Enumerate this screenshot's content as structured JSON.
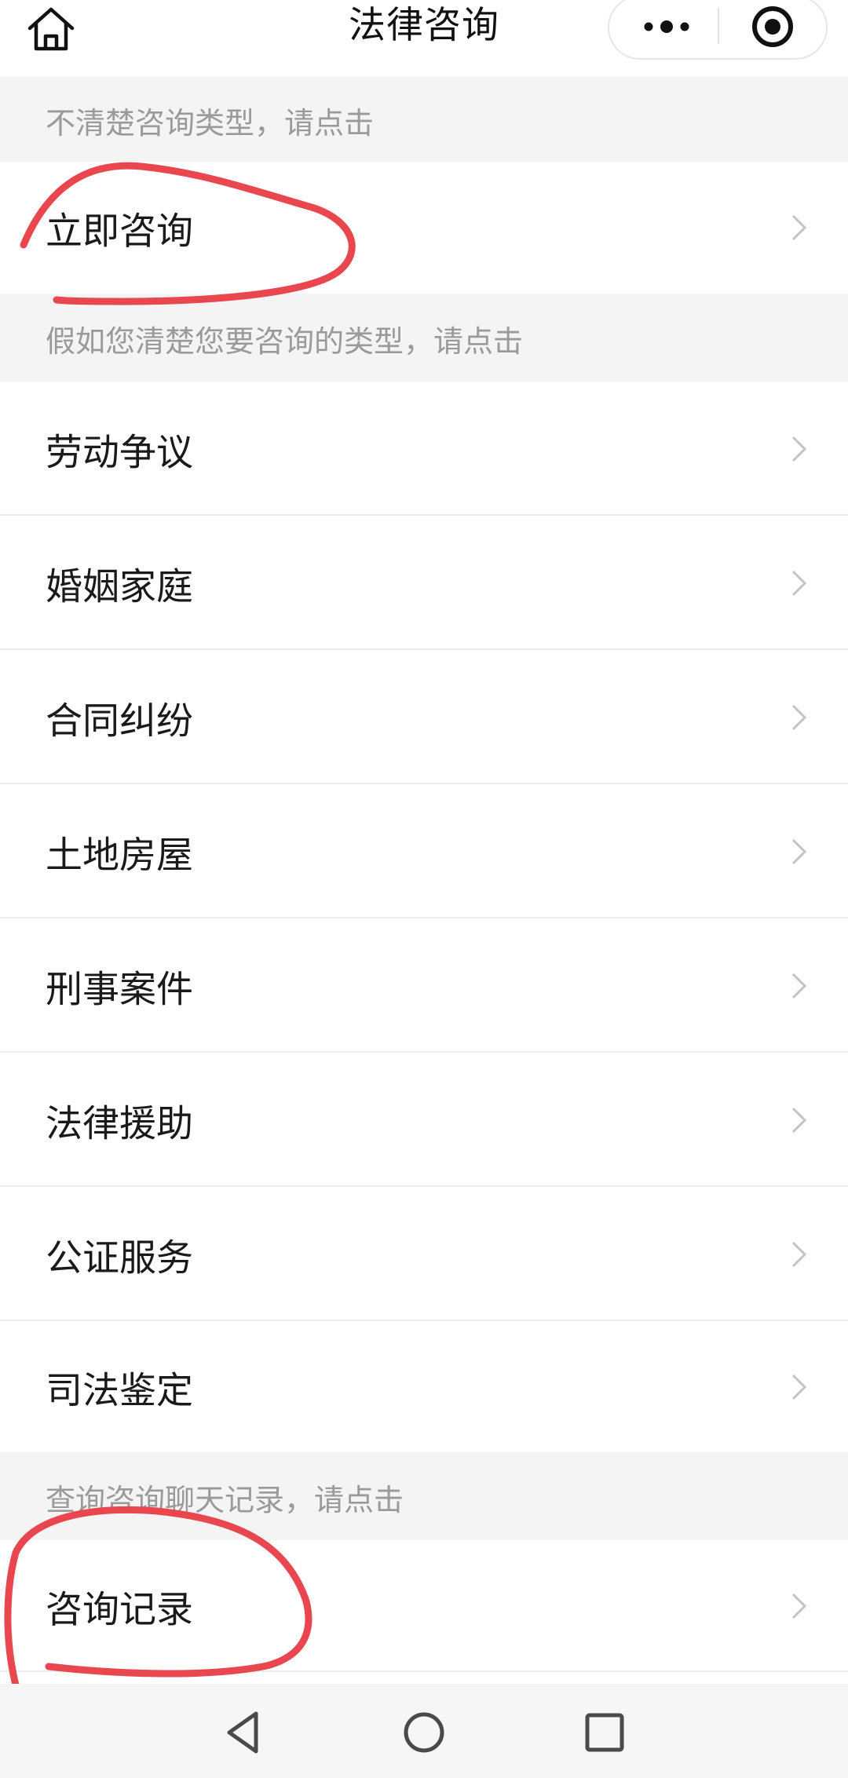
{
  "header": {
    "title": "法律咨询",
    "home_icon": "home-icon",
    "more_icon": "more-dots-icon",
    "close_icon": "target-circle-icon"
  },
  "sections": {
    "unsure": {
      "hint": "不清楚咨询类型，请点击",
      "items": [
        {
          "label": "立即咨询"
        }
      ]
    },
    "categories": {
      "hint": "假如您清楚您要咨询的类型，请点击",
      "items": [
        {
          "label": "劳动争议"
        },
        {
          "label": "婚姻家庭"
        },
        {
          "label": "合同纠纷"
        },
        {
          "label": "土地房屋"
        },
        {
          "label": "刑事案件"
        },
        {
          "label": "法律援助"
        },
        {
          "label": "公证服务"
        },
        {
          "label": "司法鉴定"
        }
      ]
    },
    "records": {
      "hint": "查询咨询聊天记录，请点击",
      "items": [
        {
          "label": "咨询记录"
        }
      ]
    }
  },
  "chevron_icon": "chevron-right-icon",
  "nav_bar": {
    "icons": [
      "back-triangle-icon",
      "home-circle-icon",
      "recents-square-icon"
    ]
  },
  "colors": {
    "section_bg": "#f4f4f4",
    "hint_text": "#9a9a9a",
    "annotation_red": "#e8474f"
  }
}
